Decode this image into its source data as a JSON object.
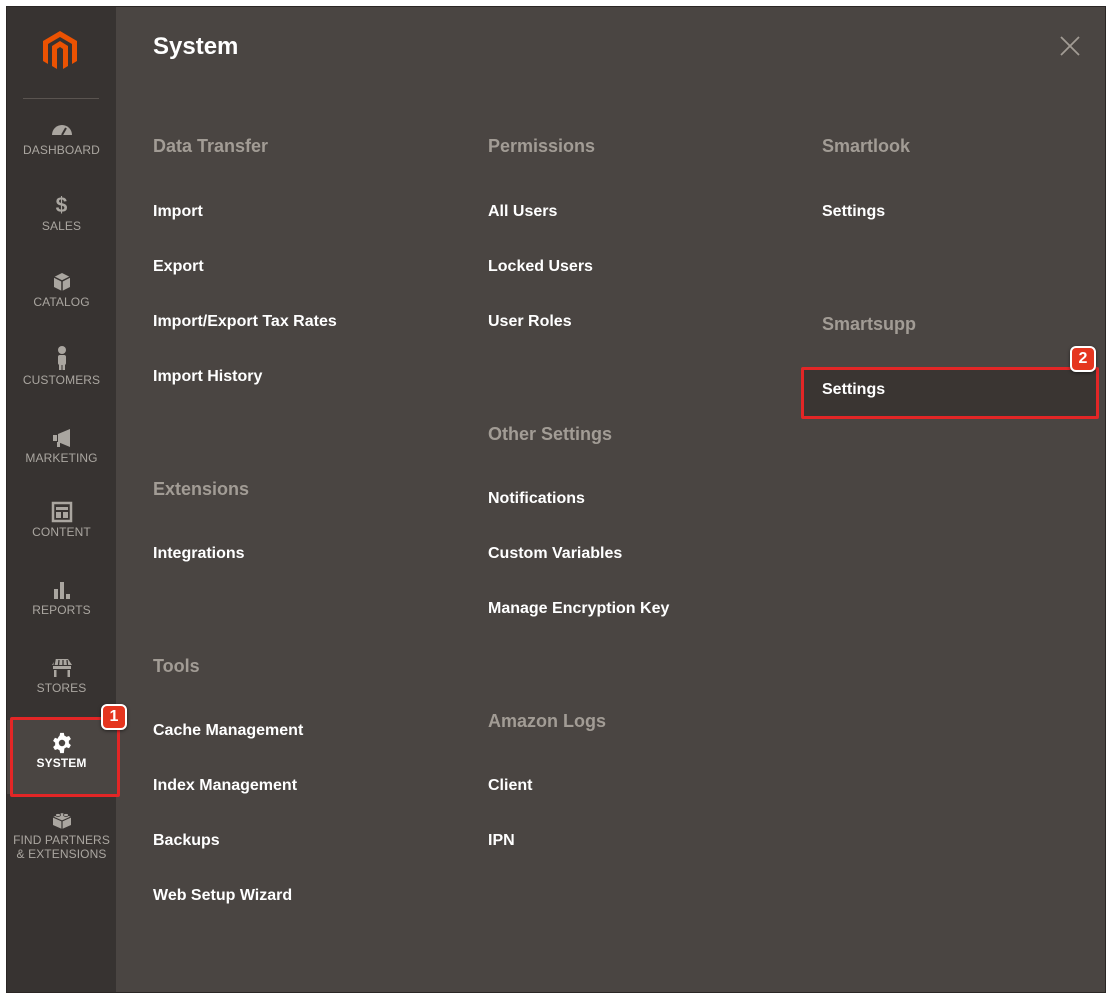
{
  "sidebar": {
    "items": [
      {
        "label": "DASHBOARD",
        "icon": "dashboard-icon"
      },
      {
        "label": "$",
        "sub": "SALES",
        "icon": "dollar-icon"
      },
      {
        "label": "CATALOG",
        "icon": "catalog-box-icon"
      },
      {
        "label": "CUSTOMERS",
        "icon": "customer-person-icon"
      },
      {
        "label": "MARKETING",
        "icon": "megaphone-icon"
      },
      {
        "label": "CONTENT",
        "icon": "content-layout-icon"
      },
      {
        "label": "REPORTS",
        "icon": "bar-chart-icon"
      },
      {
        "label": "STORES",
        "icon": "store-awning-icon"
      },
      {
        "label": "SYSTEM",
        "icon": "gear-icon"
      },
      {
        "label1": "FIND PARTNERS",
        "label2": "& EXTENSIONS",
        "icon": "lego-brick-icon"
      }
    ]
  },
  "panel": {
    "title": "System",
    "columns": {
      "col1": {
        "data_transfer": {
          "title": "Data Transfer",
          "links": [
            "Import",
            "Export",
            "Import/Export Tax Rates",
            "Import History"
          ]
        },
        "extensions": {
          "title": "Extensions",
          "links": [
            "Integrations"
          ]
        },
        "tools": {
          "title": "Tools",
          "links": [
            "Cache Management",
            "Index Management",
            "Backups",
            "Web Setup Wizard"
          ]
        }
      },
      "col2": {
        "permissions": {
          "title": "Permissions",
          "links": [
            "All Users",
            "Locked Users",
            "User Roles"
          ]
        },
        "other_settings": {
          "title": "Other Settings",
          "links": [
            "Notifications",
            "Custom Variables",
            "Manage Encryption Key"
          ]
        },
        "amazon_logs": {
          "title": "Amazon Logs",
          "links": [
            "Client",
            "IPN"
          ]
        }
      },
      "col3": {
        "smartlook": {
          "title": "Smartlook",
          "links": [
            "Settings"
          ]
        },
        "smartsupp": {
          "title": "Smartsupp",
          "links": [
            "Settings"
          ]
        }
      }
    }
  },
  "annotations": {
    "badge1": "1",
    "badge2": "2"
  },
  "colors": {
    "sidebar_bg": "#373331",
    "panel_bg": "#4a4542",
    "accent_orange": "#eb5202",
    "highlight_red": "#e22626",
    "section_title": "#a29c95"
  }
}
